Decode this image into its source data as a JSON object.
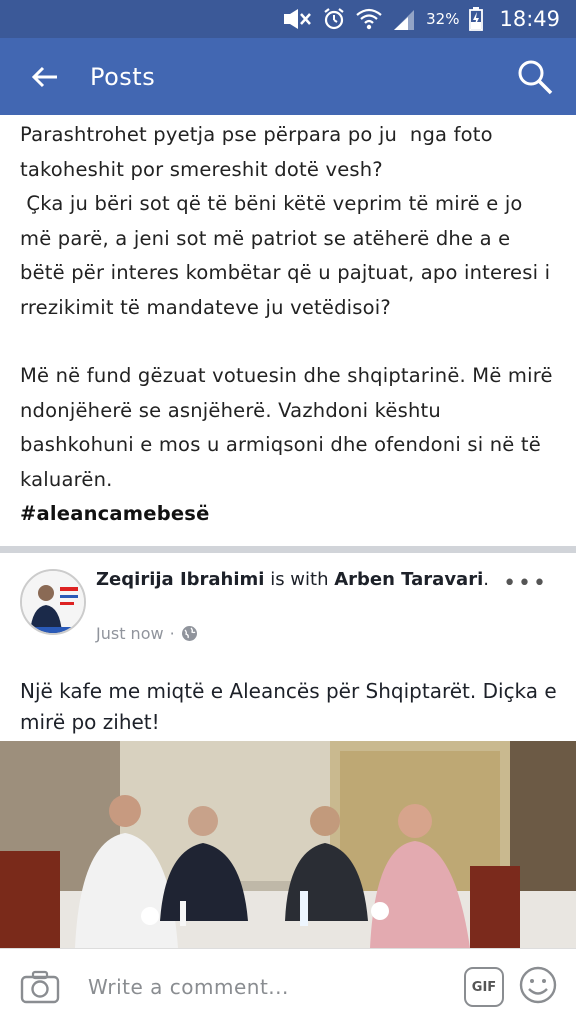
{
  "status_bar": {
    "battery": "32%",
    "time": "18:49",
    "icons": [
      "mute-icon",
      "alarm-icon",
      "wifi-icon",
      "signal-icon",
      "battery-icon"
    ]
  },
  "app_bar": {
    "title": "Posts",
    "back_icon": "back-arrow-icon",
    "search_icon": "search-icon",
    "color": "#4267b2"
  },
  "post": {
    "paragraphs": [
      "Parashtrohet pyetja pse përpara po ju  nga foto takoheshit por smereshit dotë vesh?\n Çka ju bëri sot që të bëni këtë veprim të mirë e jo më parë, a jeni sot më patriot se atëherë dhe a e bëtë për interes kombëtar që u pajtuat, apo interesi i rrezikimit të mandateve ju vetëdisoi?",
      "Më në fund gëzuat votuesin dhe shqiptarinë. Më mirë ndonjëherë se asnjëherë. Vazhdoni kështu bashkohuni e mos u armiqsoni dhe ofendoni si në të kaluarën."
    ],
    "hashtag": "#aleancamebesë"
  },
  "shared_post": {
    "author": "Zeqirija Ibrahimi",
    "with_text": " is with ",
    "tagged": "Arben Taravari",
    "tagged_suffix": ".",
    "time": "Just now",
    "separator": "·",
    "privacy_icon": "globe-icon",
    "more_icon": "more-options-icon",
    "more": "•••",
    "text": "Një kafe me miqtë e Aleancës për Shqiptarët. Diçka e mirë po zihet!"
  },
  "comment_bar": {
    "placeholder": "Write a comment...",
    "gif_label": "GIF",
    "camera_icon": "camera-icon",
    "emoji_icon": "emoji-icon"
  }
}
